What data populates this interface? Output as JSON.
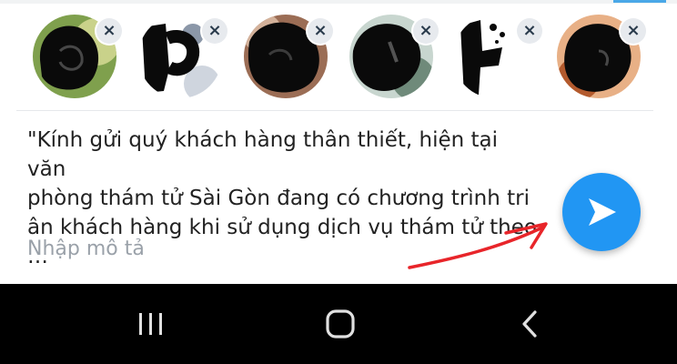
{
  "recipients": [
    {
      "name": "recipient-1",
      "remove_icon": "close-icon",
      "photo_colors": [
        "#7fa04d",
        "#c9d28a"
      ]
    },
    {
      "name": "recipient-2",
      "remove_icon": "close-icon",
      "photo_colors": [
        "#cfd5de",
        "#8b97a8"
      ]
    },
    {
      "name": "recipient-3",
      "remove_icon": "close-icon",
      "photo_colors": [
        "#9b6d55",
        "#d3b19a"
      ]
    },
    {
      "name": "recipient-4",
      "remove_icon": "close-icon",
      "photo_colors": [
        "#6f8a7a",
        "#c8d6cf"
      ]
    },
    {
      "name": "recipient-5",
      "remove_icon": "close-icon",
      "photo_colors": [
        "#ffffff",
        "#e9e9e9"
      ]
    },
    {
      "name": "recipient-6",
      "remove_icon": "close-icon",
      "photo_colors": [
        "#b35a2d",
        "#e8b086"
      ]
    }
  ],
  "message": {
    "text": "\"Kính gửi quý khách hàng thân thiết, hiện tại văn\nphòng thám tử Sài Gòn đang có chương trình tri\nân khách hàng khi sử dụng dịch vụ thám tử theo …"
  },
  "description": {
    "placeholder": "Nhập mô tả",
    "value": ""
  },
  "send": {
    "icon": "send-icon",
    "color": "#2196f3"
  },
  "annotation": {
    "color": "#e8252a",
    "icon": "arrow-annotation"
  },
  "navigation_bar": {
    "background": "#000000",
    "buttons": [
      {
        "name": "recent-apps-button",
        "icon": "recent-apps-icon"
      },
      {
        "name": "home-button",
        "icon": "home-icon"
      },
      {
        "name": "back-button",
        "icon": "back-icon"
      }
    ]
  },
  "theme": {
    "accent": "#2196f3",
    "text": "#222222",
    "placeholder": "#9aa1a9"
  }
}
